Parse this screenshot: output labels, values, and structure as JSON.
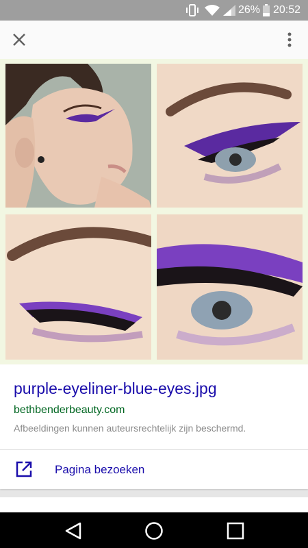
{
  "status_bar": {
    "battery_percent": "26%",
    "time": "20:52",
    "icons": [
      "vibrate-icon",
      "wifi-icon",
      "signal-icon",
      "battery-icon"
    ]
  },
  "top_bar": {
    "icons": [
      "close-icon",
      "more-vert-icon"
    ]
  },
  "image": {
    "tiles": [
      "eyeliner-photo-model",
      "eyeliner-photo-eye-open",
      "eyeliner-photo-eye-closed",
      "eyeliner-photo-eye-closeup"
    ]
  },
  "result": {
    "file_name": "purple-eyeliner-blue-eyes.jpg",
    "source": "bethbenderbeauty.com",
    "copyright_notice": "Afbeeldingen kunnen auteursrechtelijk zijn beschermd.",
    "visit_label": "Pagina bezoeken"
  },
  "nav_bar": {
    "icons": [
      "back-icon",
      "home-icon",
      "recents-icon"
    ]
  },
  "colors": {
    "link_blue": "#1a0dab",
    "source_green": "#006621",
    "status_bar_grey": "#9e9e9e",
    "image_backdrop": "#f2f7e2"
  }
}
